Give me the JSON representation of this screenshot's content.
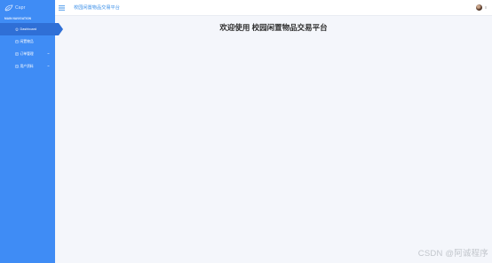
{
  "brand": {
    "name": "Capr",
    "logo_icon": "leaf-logo-icon"
  },
  "sidebar": {
    "heading": "MAIN NAVIGATION",
    "items": [
      {
        "label": "Dashboard",
        "icon": "home-icon",
        "active": true,
        "has_submenu": false
      },
      {
        "label": "闲置物品",
        "icon": "box-icon",
        "active": false,
        "has_submenu": false
      },
      {
        "label": "订单管理",
        "icon": "order-icon",
        "active": false,
        "has_submenu": true
      },
      {
        "label": "用户资料",
        "icon": "user-card-icon",
        "active": false,
        "has_submenu": true
      }
    ]
  },
  "header": {
    "menu_icon": "hamburger-icon",
    "title": "校园闲置物品交易平台"
  },
  "main": {
    "welcome_text": "欢迎使用 校园闲置物品交易平台"
  },
  "watermark": "CSDN @阿诚程序",
  "colors": {
    "sidebar_bg": "#3f8cf5",
    "sidebar_active": "#2f6fd6",
    "accent": "#3b8fe8",
    "content_bg": "#f4f6fb"
  }
}
